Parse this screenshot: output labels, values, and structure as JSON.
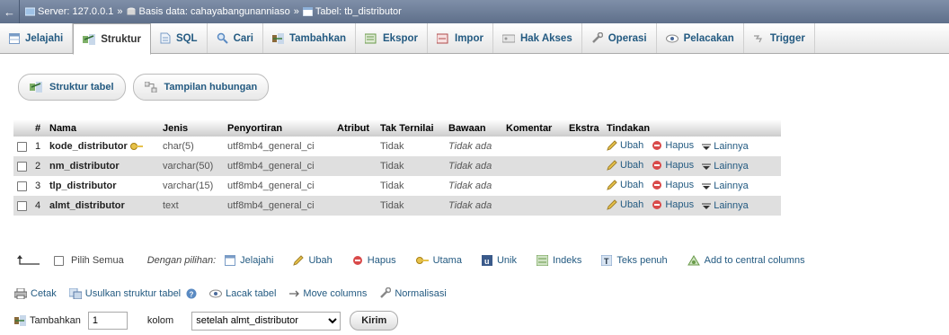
{
  "breadcrumb": {
    "server": "Server: 127.0.0.1",
    "database": "Basis data: cahayabangunanniaso",
    "table": "Tabel: tb_distributor",
    "separator": "»"
  },
  "tabs": [
    {
      "label": "Jelajahi",
      "icon": "browse-icon"
    },
    {
      "label": "Struktur",
      "icon": "structure-icon",
      "active": true
    },
    {
      "label": "SQL",
      "icon": "sql-icon"
    },
    {
      "label": "Cari",
      "icon": "search-icon"
    },
    {
      "label": "Tambahkan",
      "icon": "insert-icon"
    },
    {
      "label": "Ekspor",
      "icon": "export-icon"
    },
    {
      "label": "Impor",
      "icon": "import-icon"
    },
    {
      "label": "Hak Akses",
      "icon": "privileges-icon"
    },
    {
      "label": "Operasi",
      "icon": "operations-icon"
    },
    {
      "label": "Pelacakan",
      "icon": "tracking-icon"
    },
    {
      "label": "Trigger",
      "icon": "triggers-icon"
    }
  ],
  "subnav": {
    "structure_label": "Struktur tabel",
    "relations_label": "Tampilan hubungan"
  },
  "table": {
    "headers": [
      "#",
      "Nama",
      "Jenis",
      "Penyortiran",
      "Atribut",
      "Tak Ternilai",
      "Bawaan",
      "Komentar",
      "Ekstra",
      "Tindakan"
    ],
    "rows": [
      {
        "num": "1",
        "name": "kode_distributor",
        "type": "char(5)",
        "collation": "utf8mb4_general_ci",
        "null": "Tidak",
        "default": "Tidak ada",
        "primary": true
      },
      {
        "num": "2",
        "name": "nm_distributor",
        "type": "varchar(50)",
        "collation": "utf8mb4_general_ci",
        "null": "Tidak",
        "default": "Tidak ada"
      },
      {
        "num": "3",
        "name": "tlp_distributor",
        "type": "varchar(15)",
        "collation": "utf8mb4_general_ci",
        "null": "Tidak",
        "default": "Tidak ada"
      },
      {
        "num": "4",
        "name": "almt_distributor",
        "type": "text",
        "collation": "utf8mb4_general_ci",
        "null": "Tidak",
        "default": "Tidak ada"
      }
    ],
    "actions": {
      "edit": "Ubah",
      "drop": "Hapus",
      "more": "Lainnya"
    }
  },
  "bulk": {
    "select_all": "Pilih Semua",
    "with_selected": "Dengan pilihan:",
    "browse": "Jelajahi",
    "edit": "Ubah",
    "drop": "Hapus",
    "primary": "Utama",
    "unique": "Unik",
    "index": "Indeks",
    "fulltext": "Teks penuh",
    "central": "Add to central columns"
  },
  "links": {
    "print": "Cetak",
    "propose": "Usulkan struktur tabel",
    "track": "Lacak tabel",
    "move": "Move columns",
    "normalize": "Normalisasi"
  },
  "addrow": {
    "label": "Tambahkan",
    "count": "1",
    "unit": "kolom",
    "position": "setelah almt_distributor",
    "submit": "Kirim"
  }
}
